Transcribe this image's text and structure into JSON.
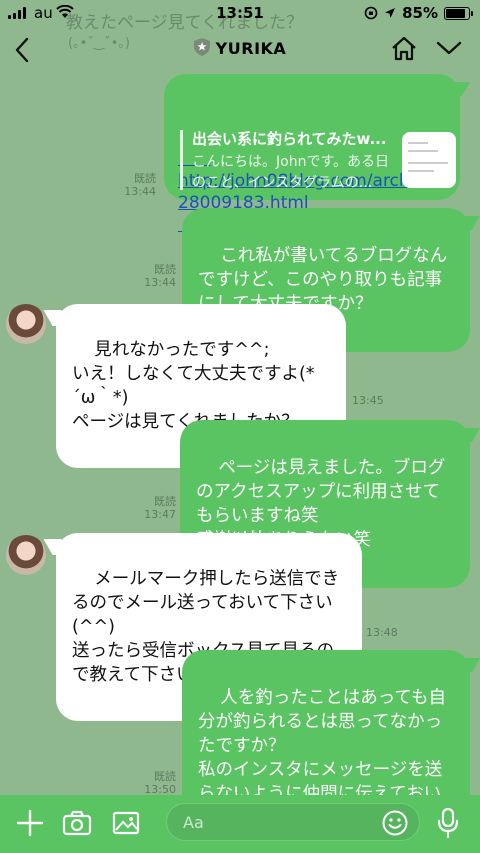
{
  "status": {
    "carrier": "au",
    "time": "13:51",
    "battery": "85%",
    "battery_level": 0.85
  },
  "notification": {
    "line1": "教えたページ見てくれました？",
    "line2": "(｡•ˇ‿ˇ•｡)"
  },
  "header": {
    "title": "YURIKA"
  },
  "messages": [
    {
      "read": "既読",
      "time": "13:44",
      "url_line1": "http://john08blog.com/archives/",
      "url_line2": "28009183.html",
      "preview_title": "出会い系に釣られてみたw...",
      "preview_desc": "こんにちは。Johnです。ある日のこと、インスタグラムの..."
    },
    {
      "read": "既読",
      "time": "13:44",
      "text": "これ私が書いてるブログなんですけど、このやり取りも記事にして大丈夫ですか？"
    },
    {
      "time": "13:45",
      "text": "見れなかったです^^;\nいえ！しなくて大丈夫ですよ(*´ω｀*)\nページは見てくれましたか？"
    },
    {
      "read": "既読",
      "time": "13:47",
      "text": "ページは見えました。ブログのアクセスアップに利用させてもらいますね笑\n感謝以外ありえない笑"
    },
    {
      "time": "13:48",
      "text": "メールマーク押したら送信できるのでメール送っておいて下さい(^^)\n送ったら受信ボックス見て見るので教えて下さいね！！"
    },
    {
      "read": "既読",
      "time": "13:50",
      "text": "人を釣ったことはあっても自分が釣られるとは思ってなかったですか？\n私のインスタにメッセージを送らないように仲間に伝えておいてくださいね。"
    }
  ],
  "input": {
    "placeholder": "Aa"
  },
  "colors": {
    "background": "#8fb88f",
    "my_bubble": "#5ac463",
    "their_bubble": "#ffffff",
    "link": "#1a53b8"
  }
}
